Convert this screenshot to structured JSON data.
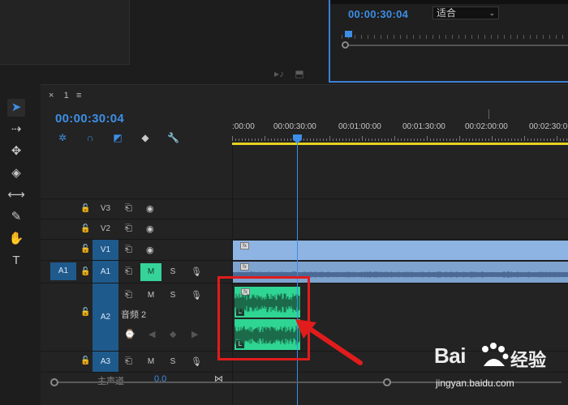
{
  "program_monitor": {
    "timecode": "00:00:30:04",
    "fit_label": "适合"
  },
  "timeline": {
    "tab_close": "×",
    "tab_name": "1",
    "tab_menu": "≡",
    "timecode": "00:00:30:04",
    "ruler_labels": [
      ":00:00",
      "00:00:30:00",
      "00:01:00:00",
      "00:01:30:00",
      "00:02:00:00",
      "00:02:30:0"
    ],
    "tracks": [
      {
        "name": "V3",
        "kind": "video"
      },
      {
        "name": "V2",
        "kind": "video"
      },
      {
        "name": "V1",
        "kind": "video",
        "selected": true
      },
      {
        "name": "A1",
        "kind": "audio",
        "source": "A1",
        "selected": true,
        "mute_on": true
      },
      {
        "name": "A2",
        "kind": "audio",
        "label": "音频 2",
        "selected": true
      },
      {
        "name": "A3",
        "kind": "audio"
      }
    ],
    "mute_label": "M",
    "solo_label": "S",
    "master_label": "主声道",
    "master_value": "0.0",
    "clip_fx_label": "fx",
    "clip_channel_label": "L"
  },
  "watermark": {
    "brand": "Bai",
    "brand_suffix": "经验",
    "url": "jingyan.baidu.com"
  },
  "colors": {
    "accent_blue": "#3d8ee6",
    "mute_green": "#35d39a",
    "clip_green": "#2fd693",
    "video_clip": "#8db4e2",
    "annotation_red": "#e01c1c",
    "work_area_yellow": "#e6d31f"
  }
}
